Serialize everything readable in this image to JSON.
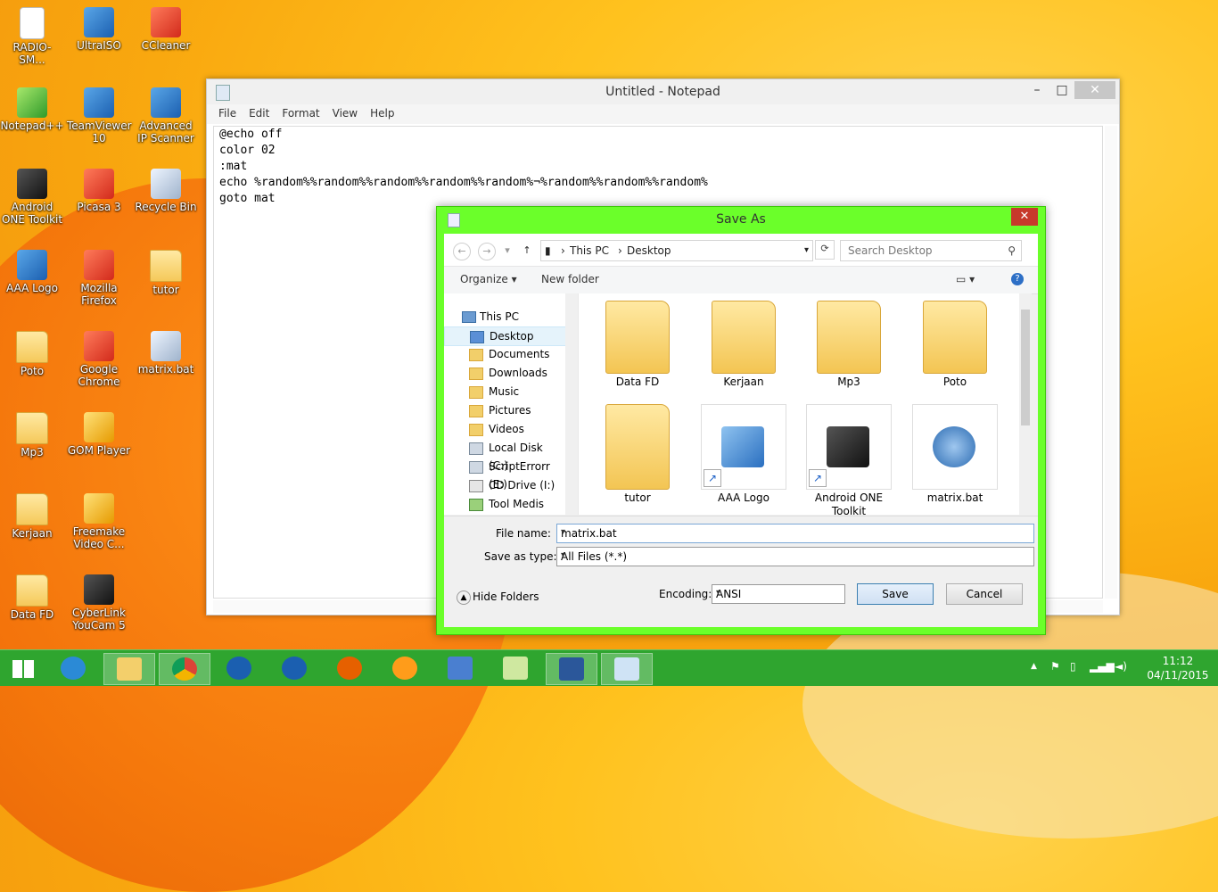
{
  "desktop": {
    "icons": [
      {
        "label": "RADIO-SM...",
        "type": "file"
      },
      {
        "label": "UltraISO",
        "type": "app"
      },
      {
        "label": "CCleaner",
        "type": "app red"
      },
      {
        "label": "Notepad++",
        "type": "app green"
      },
      {
        "label": "TeamViewer 10",
        "type": "app"
      },
      {
        "label": "Advanced IP Scanner",
        "type": "app"
      },
      {
        "label": "Android ONE Toolkit",
        "type": "app dark"
      },
      {
        "label": "Picasa 3",
        "type": "app red"
      },
      {
        "label": "Recycle Bin",
        "type": "app grey"
      },
      {
        "label": "AAA Logo",
        "type": "app"
      },
      {
        "label": "Mozilla Firefox",
        "type": "app red"
      },
      {
        "label": "tutor",
        "type": "folder"
      },
      {
        "label": "Poto",
        "type": "folder"
      },
      {
        "label": "Google Chrome",
        "type": "app red"
      },
      {
        "label": "matrix.bat",
        "type": "app grey"
      },
      {
        "label": "Mp3",
        "type": "folder"
      },
      {
        "label": "GOM Player",
        "type": "app yellow"
      },
      {
        "label": "Kerjaan",
        "type": "folder"
      },
      {
        "label": "Freemake Video C...",
        "type": "app yellow"
      },
      {
        "label": "Data FD",
        "type": "folder"
      },
      {
        "label": "CyberLink YouCam 5",
        "type": "app dark"
      }
    ]
  },
  "notepad": {
    "title": "Untitled - Notepad",
    "menu": [
      "File",
      "Edit",
      "Format",
      "View",
      "Help"
    ],
    "lines": [
      "@echo off",
      "color 02",
      ":mat",
      "echo %random%%random%%random%%random%%random%¬%random%%random%%random%",
      "goto mat"
    ],
    "controls": {
      "minimize": "–",
      "maximize": "□",
      "close": "✕"
    }
  },
  "saveas": {
    "title": "Save As",
    "close": "✕",
    "address": {
      "root": "This PC",
      "sep": "›",
      "folder": "Desktop"
    },
    "search_placeholder": "Search Desktop",
    "toolbar": {
      "organize": "Organize ▾",
      "new_folder": "New folder",
      "help": "?"
    },
    "nav": [
      {
        "label": "This PC"
      },
      {
        "label": "Desktop"
      },
      {
        "label": "Documents"
      },
      {
        "label": "Downloads"
      },
      {
        "label": "Music"
      },
      {
        "label": "Pictures"
      },
      {
        "label": "Videos"
      },
      {
        "label": "Local Disk (C:)"
      },
      {
        "label": "ScriptErrorr (E:)"
      },
      {
        "label": "CD Drive (I:)"
      },
      {
        "label": "Tool Medis (K:)"
      }
    ],
    "files": [
      {
        "label": "Data FD"
      },
      {
        "label": "Kerjaan"
      },
      {
        "label": "Mp3"
      },
      {
        "label": "Poto"
      },
      {
        "label": "tutor"
      },
      {
        "label": "AAA Logo"
      },
      {
        "label": "Android ONE Toolkit"
      },
      {
        "label": "matrix.bat"
      }
    ],
    "file_name_label": "File name:",
    "file_name_value": "matrix.bat",
    "save_type_label": "Save as type:",
    "save_type_value": "All Files  (*.*)",
    "hide_folders": "Hide Folders",
    "encoding_label": "Encoding:",
    "encoding_value": "ANSI",
    "save": "Save",
    "cancel": "Cancel"
  },
  "taskbar": {
    "clock_time": "11:12",
    "clock_date": "04/11/2015",
    "tray_chevron": "▲"
  },
  "colors": {
    "dialog_border": "#6bff2a",
    "taskbar": "#2fa52f",
    "desktop": "#ffc21e"
  }
}
